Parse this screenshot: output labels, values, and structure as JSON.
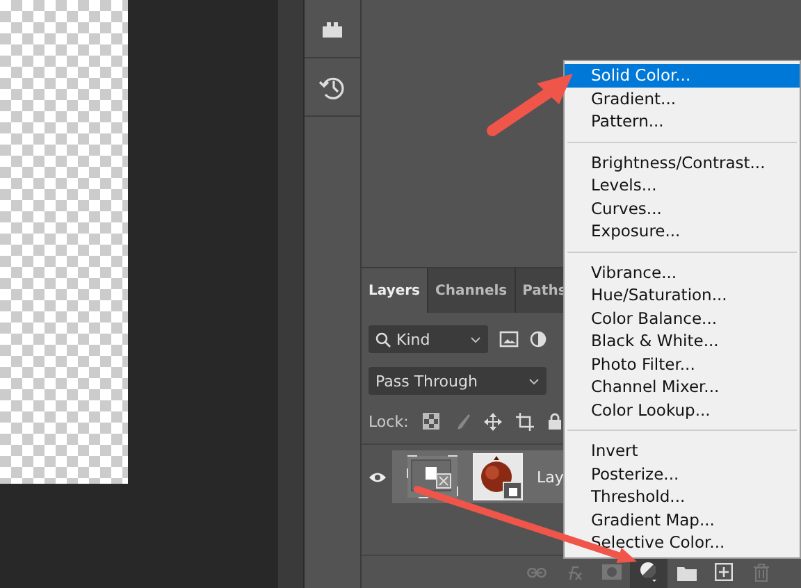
{
  "layers_panel": {
    "tabs": [
      {
        "label": "Layers",
        "selected": true
      },
      {
        "label": "Channels",
        "selected": false
      },
      {
        "label": "Paths",
        "selected": false
      }
    ],
    "filter": {
      "value": "Kind"
    },
    "blend_mode": {
      "value": "Pass Through"
    },
    "lock_label": "Lock:",
    "layers": [
      {
        "name": "Lay",
        "visible": true
      }
    ],
    "footer_tools": [
      {
        "kind": "link",
        "selected": false
      },
      {
        "kind": "fx",
        "selected": false
      },
      {
        "kind": "mask",
        "selected": false
      },
      {
        "kind": "adjustment",
        "selected": true
      },
      {
        "kind": "folder",
        "selected": false
      },
      {
        "kind": "new",
        "selected": false
      },
      {
        "kind": "trash",
        "selected": false
      }
    ]
  },
  "adjustment_menu": [
    {
      "kind": "item",
      "label": "Solid Color...",
      "selected": true
    },
    {
      "kind": "item",
      "label": "Gradient...",
      "selected": false
    },
    {
      "kind": "item",
      "label": "Pattern...",
      "selected": false
    },
    {
      "kind": "separator"
    },
    {
      "kind": "item",
      "label": "Brightness/Contrast...",
      "selected": false
    },
    {
      "kind": "item",
      "label": "Levels...",
      "selected": false
    },
    {
      "kind": "item",
      "label": "Curves...",
      "selected": false
    },
    {
      "kind": "item",
      "label": "Exposure...",
      "selected": false
    },
    {
      "kind": "separator"
    },
    {
      "kind": "item",
      "label": "Vibrance...",
      "selected": false
    },
    {
      "kind": "item",
      "label": "Hue/Saturation...",
      "selected": false
    },
    {
      "kind": "item",
      "label": "Color Balance...",
      "selected": false
    },
    {
      "kind": "item",
      "label": "Black & White...",
      "selected": false
    },
    {
      "kind": "item",
      "label": "Photo Filter...",
      "selected": false
    },
    {
      "kind": "item",
      "label": "Channel Mixer...",
      "selected": false
    },
    {
      "kind": "item",
      "label": "Color Lookup...",
      "selected": false
    },
    {
      "kind": "separator"
    },
    {
      "kind": "item",
      "label": "Invert",
      "selected": false
    },
    {
      "kind": "item",
      "label": "Posterize...",
      "selected": false
    },
    {
      "kind": "item",
      "label": "Threshold...",
      "selected": false
    },
    {
      "kind": "item",
      "label": "Gradient Map...",
      "selected": false
    },
    {
      "kind": "item",
      "label": "Selective Color...",
      "selected": false
    }
  ]
}
